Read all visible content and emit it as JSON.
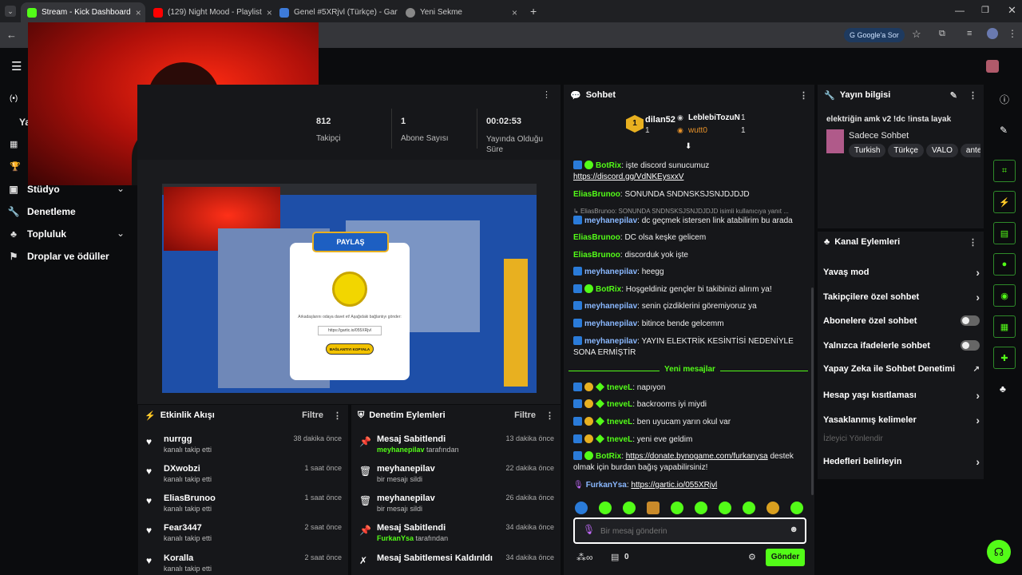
{
  "browser": {
    "tabs": [
      {
        "title": "Stream - Kick Dashboard",
        "color": "#53fc18",
        "active": true
      },
      {
        "title": "(129) Night Mood - Playlist",
        "color": "#ff0000",
        "active": false
      },
      {
        "title": "Genel #5XRjvl (Türkçe) - Gartic",
        "color": "#3d7bd9",
        "active": false
      },
      {
        "title": "Yeni Sekme",
        "color": "#888888",
        "active": false
      }
    ],
    "new_tab": "+",
    "search_chip": "Google'a Sor"
  },
  "sidebar": {
    "items": [
      {
        "label": "Stüdyo",
        "icon": "studio-icon"
      },
      {
        "label": "Denetleme",
        "icon": "wrench-icon"
      },
      {
        "label": "Topluluk",
        "icon": "community-icon"
      },
      {
        "label": "Droplar ve ödüller",
        "icon": "drops-icon"
      }
    ],
    "partial_label": "Ya"
  },
  "stats": {
    "followers_value": "812",
    "followers_label": "Takipçi",
    "subs_value": "1",
    "subs_label": "Abone Sayısı",
    "uptime_value": "00:02:53",
    "uptime_label": "Yayında Olduğu Süre"
  },
  "stream_preview": {
    "popup_title": "PAYLAŞ",
    "popup_text": "Arkadaşlarını odaya davet et! Aşağıdaki bağlantıyı gönder:",
    "popup_link": "https://gartic.io/055XRjvl",
    "popup_button": "BAĞLANTIYI KOPYALA"
  },
  "activity_feed": {
    "title": "Etkinlik Akışı",
    "filter": "Filtre",
    "items": [
      {
        "name": "nurrgg",
        "action": "kanalı takip etti",
        "time": "38 dakika önce"
      },
      {
        "name": "DXwobzi",
        "action": "kanalı takip etti",
        "time": "1 saat önce"
      },
      {
        "name": "EliasBrunoo",
        "action": "kanalı takip etti",
        "time": "1 saat önce"
      },
      {
        "name": "Fear3447",
        "action": "kanalı takip etti",
        "time": "2 saat önce"
      },
      {
        "name": "Koralla",
        "action": "kanalı takip etti",
        "time": "2 saat önce"
      }
    ]
  },
  "mod_actions": {
    "title": "Denetim Eylemleri",
    "filter": "Filtre",
    "items": [
      {
        "title": "Mesaj Sabitlendi",
        "user": "meyhanepilav",
        "detail": "tarafından",
        "time": "13 dakika önce",
        "icon": "pin-icon"
      },
      {
        "title": "meyhanepilav",
        "user": "",
        "detail": "bir mesajı sildi",
        "time": "22 dakika önce",
        "icon": "trash-icon"
      },
      {
        "title": "meyhanepilav",
        "user": "",
        "detail": "bir mesajı sildi",
        "time": "26 dakika önce",
        "icon": "trash-icon"
      },
      {
        "title": "Mesaj Sabitlendi",
        "user": "FurkanYsa",
        "detail": "tarafından",
        "time": "34 dakika önce",
        "icon": "pin-icon"
      },
      {
        "title": "Mesaj Sabitlemesi Kaldırıldı",
        "user": "",
        "detail": "",
        "time": "34 dakika önce",
        "icon": "unpin-icon"
      }
    ]
  },
  "chat": {
    "title": "Sohbet",
    "leaders": {
      "first_name": "dilan52",
      "first_count": "1",
      "second_name": "LeblebiTozuN",
      "second_count": "1",
      "third_name": "wutt0",
      "third_count": "1"
    },
    "messages": [
      {
        "user": "BotRix",
        "text": ": işte discord sunucumuz",
        "link": "https://discord.gg/VdNKEysxxV"
      },
      {
        "user": "EliasBrunoo",
        "text": ": SONUNDA SNDNSKSJSNJDJDJD"
      },
      {
        "reply": "EliasBrunoo: SONUNDA SNDNSKSJSNJDJDJD isimli kullanıcıya yanıt ..."
      },
      {
        "user": "meyhanepilav",
        "text": ": dc geçmek istersen link atabilirim bu arada"
      },
      {
        "user": "EliasBrunoo",
        "text": ": DC olsa keşke gelicem"
      },
      {
        "user": "EliasBrunoo",
        "text": ": discorduk yok işte"
      },
      {
        "user": "meyhanepilav",
        "text": ": heegg"
      },
      {
        "user": "BotRix",
        "text": ": Hoşgeldiniz gençler bi takibinizi alırım ya!"
      },
      {
        "user": "meyhanepilav",
        "text": ": senin çizdiklerini göremiyoruz ya"
      },
      {
        "user": "meyhanepilav",
        "text": ": bitince bende gelcemm"
      },
      {
        "user": "meyhanepilav",
        "text": ": YAYIN ELEKTRİK KESİNTİSİ NEDENİYLE SONA ERMİŞTİR"
      }
    ],
    "new_messages_label": "Yeni mesajlar",
    "new_messages": [
      {
        "user": "tneveL",
        "text": ": napıyon"
      },
      {
        "user": "tneveL",
        "text": ": backrooms iyi miydi"
      },
      {
        "user": "tneveL",
        "text": ": ben uyucam yarın okul var"
      },
      {
        "user": "tneveL",
        "text": ": yeni eve geldim"
      },
      {
        "user": "BotRix",
        "link": "https://donate.bynogame.com/furkanysa",
        "text": " destek olmak için burdan bağış yapabilirsiniz!"
      },
      {
        "user": "FurkanYsa",
        "link": "https://gartic.io/055XRjvl",
        "text": ": "
      }
    ],
    "input_placeholder": "Bir mesaj gönderin",
    "points": "0",
    "send_label": "Gönder"
  },
  "stream_info": {
    "title": "Yayın bilgisi",
    "stream_title": "elektriğin amk v2 !dc !insta layak",
    "category": "Sadece Sohbet",
    "tags": [
      "Turkish",
      "Türkçe",
      "VALO",
      "ante"
    ]
  },
  "channel_actions": {
    "title": "Kanal Eylemleri",
    "items": [
      {
        "label": "Yavaş mod",
        "type": "arrow"
      },
      {
        "label": "Takipçilere özel sohbet",
        "type": "arrow"
      },
      {
        "label": "Abonelere özel sohbet",
        "type": "toggle"
      },
      {
        "label": "Yalnızca ifadelerle sohbet",
        "type": "toggle"
      },
      {
        "label": "Yapay Zeka ile Sohbet Denetimi",
        "type": "external"
      },
      {
        "label": "Hesap yaşı kısıtlaması",
        "type": "arrow"
      },
      {
        "label": "Yasaklanmış kelimeler",
        "type": "arrow"
      },
      {
        "label": "İzleyici Yönlendir",
        "type": "disabled"
      },
      {
        "label": "Hedefleri belirleyin",
        "type": "arrow"
      }
    ]
  },
  "colors": {
    "accent": "#53fc18",
    "panel": "#16171a",
    "bg": "#0b0c0e"
  }
}
